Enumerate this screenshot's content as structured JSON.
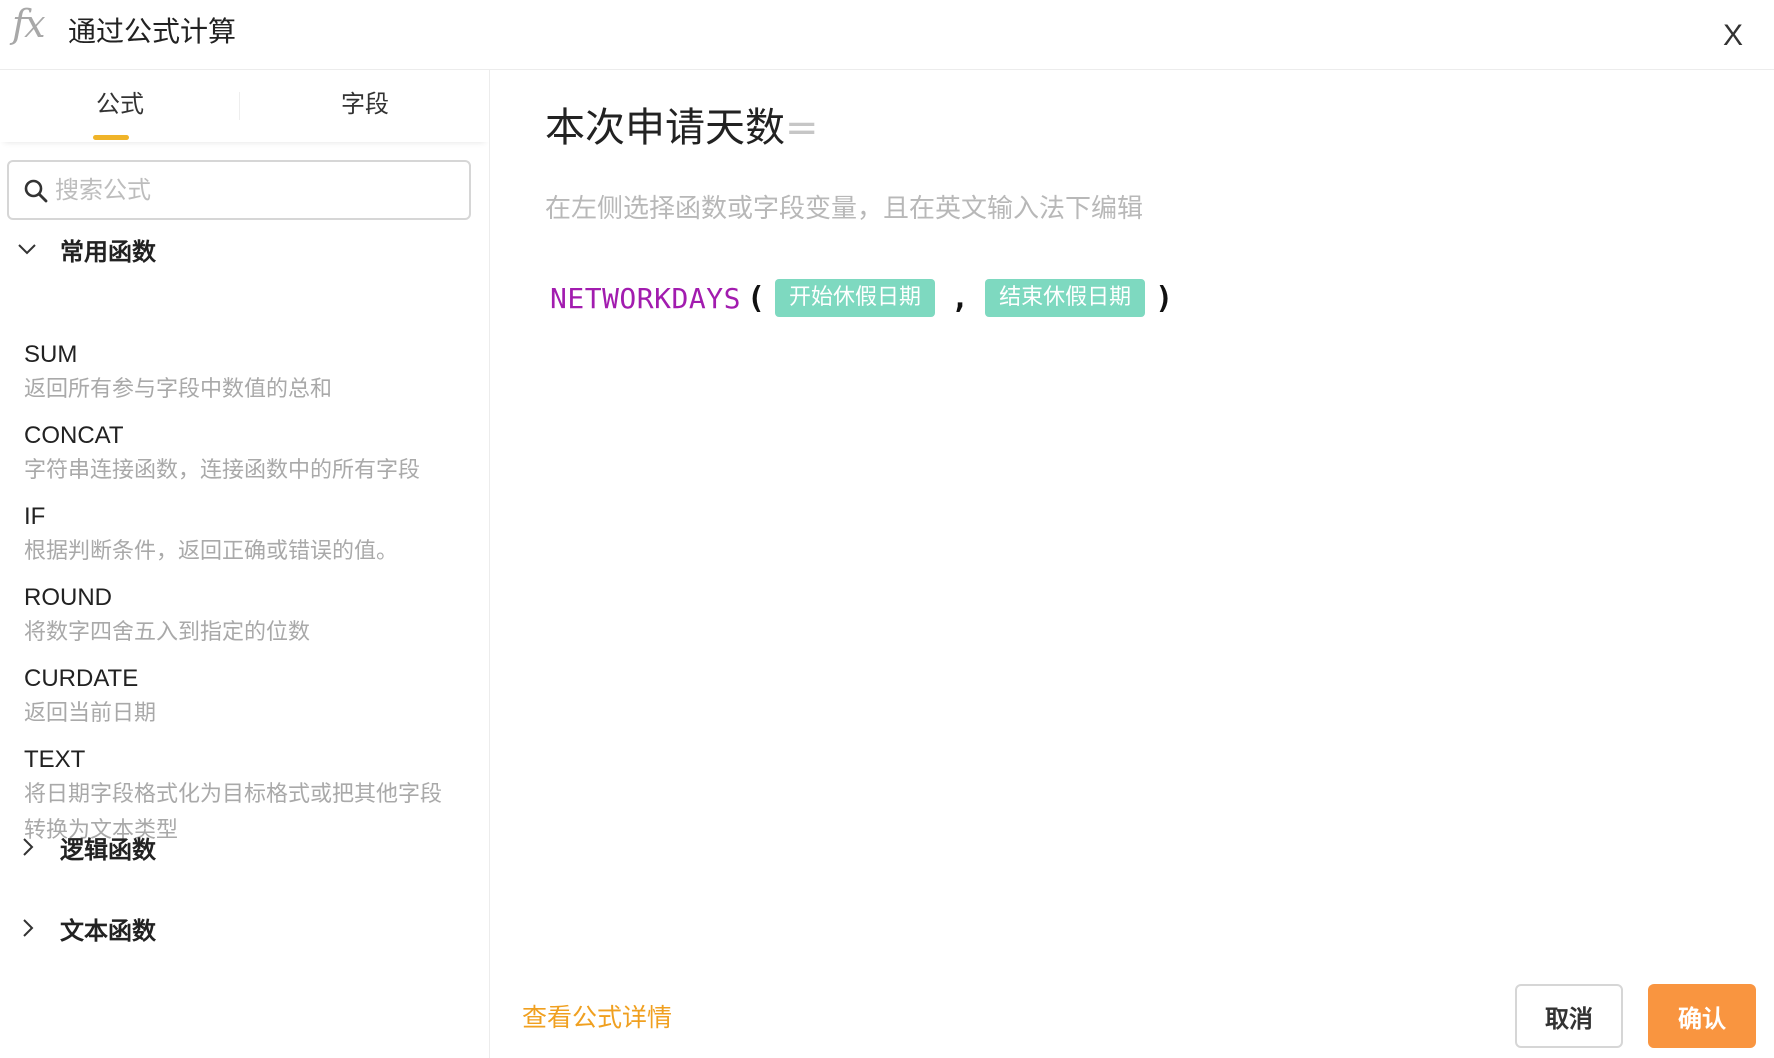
{
  "header": {
    "icon_text": "fx",
    "title": "通过公式计算",
    "close_label": "X"
  },
  "left_panel": {
    "tabs": [
      {
        "label": "公式",
        "active": true
      },
      {
        "label": "字段",
        "active": false
      }
    ],
    "search": {
      "placeholder": "搜索公式",
      "value": ""
    },
    "groups": [
      {
        "label": "常用函数",
        "expanded": true,
        "functions": [
          {
            "name": "SUM",
            "description": "返回所有参与字段中数值的总和"
          },
          {
            "name": "CONCAT",
            "description": "字符串连接函数，连接函数中的所有字段"
          },
          {
            "name": "IF",
            "description": "根据判断条件，返回正确或错误的值。"
          },
          {
            "name": "ROUND",
            "description": "将数字四舍五入到指定的位数"
          },
          {
            "name": "CURDATE",
            "description": "返回当前日期"
          },
          {
            "name": "TEXT",
            "description": "将日期字段格式化为目标格式或把其他字段转换为文本类型"
          }
        ]
      },
      {
        "label": "逻辑函数",
        "expanded": false
      },
      {
        "label": "文本函数",
        "expanded": false
      }
    ]
  },
  "right_panel": {
    "field_title": "本次申请天数",
    "equals_sign": "=",
    "hint": "在左侧选择函数或字段变量，且在英文输入法下编辑",
    "formula": {
      "function_name": "NETWORKDAYS",
      "open_paren": "(",
      "args": [
        "开始休假日期",
        "结束休假日期"
      ],
      "separator": ",",
      "close_paren": ")"
    },
    "detail_link": "查看公式详情",
    "cancel_label": "取消",
    "confirm_label": "确认"
  },
  "colors": {
    "accent": "#f0b429",
    "confirm_button": "#f99540",
    "field_chip": "#7ed9c0",
    "function_token": "#a21caf",
    "link": "#f0a020"
  },
  "icons": {
    "search": "search-icon",
    "expanded_group": "chevron-down-icon",
    "collapsed_group": "chevron-right-icon",
    "close": "close-icon"
  }
}
